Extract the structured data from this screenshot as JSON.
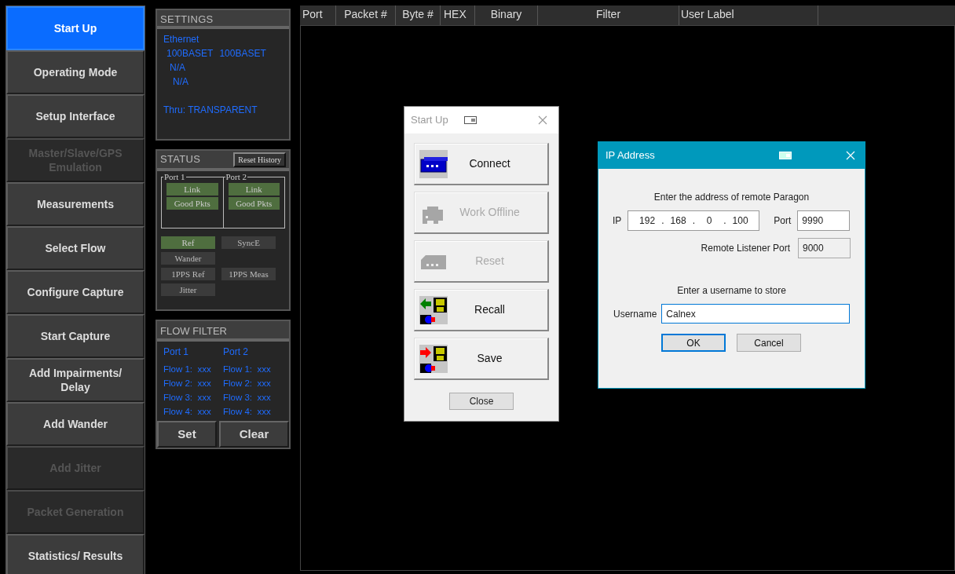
{
  "nav": [
    {
      "label": "Start Up",
      "selected": true,
      "disabled": false
    },
    {
      "label": "Operating Mode",
      "selected": false,
      "disabled": false
    },
    {
      "label": "Setup Interface",
      "selected": false,
      "disabled": false
    },
    {
      "label": "Master/Slave/GPS Emulation",
      "selected": false,
      "disabled": true
    },
    {
      "label": "Measurements",
      "selected": false,
      "disabled": false
    },
    {
      "label": "Select Flow",
      "selected": false,
      "disabled": false
    },
    {
      "label": "Configure Capture",
      "selected": false,
      "disabled": false
    },
    {
      "label": "Start Capture",
      "selected": false,
      "disabled": false
    },
    {
      "label": "Add Impairments/ Delay",
      "selected": false,
      "disabled": false
    },
    {
      "label": "Add Wander",
      "selected": false,
      "disabled": false
    },
    {
      "label": "Add Jitter",
      "selected": false,
      "disabled": true
    },
    {
      "label": "Packet Generation",
      "selected": false,
      "disabled": true
    },
    {
      "label": "Statistics/ Results",
      "selected": false,
      "disabled": false
    }
  ],
  "settings": {
    "title": "SETTINGS",
    "lines": [
      [
        "Ethernet"
      ],
      [
        "100BASET",
        "100BASET"
      ],
      [
        "N/A"
      ],
      [
        "N/A"
      ],
      [
        "Thru: TRANSPARENT"
      ]
    ]
  },
  "status": {
    "title": "STATUS",
    "reset_button": "Reset History",
    "ports": [
      {
        "label": "Port 1",
        "indicators": [
          {
            "label": "Link",
            "on": true
          },
          {
            "label": "Good Pkts",
            "on": true
          }
        ]
      },
      {
        "label": "Port 2",
        "indicators": [
          {
            "label": "Link",
            "on": true
          },
          {
            "label": "Good Pkts",
            "on": true
          }
        ]
      }
    ],
    "indicator_rows": [
      [
        {
          "label": "Ref",
          "on": true
        },
        {
          "label": "SyncE",
          "on": false
        }
      ],
      [
        {
          "label": "Wander",
          "on": false
        }
      ],
      [
        {
          "label": "1PPS Ref",
          "on": false
        },
        {
          "label": "1PPS Meas",
          "on": false
        }
      ],
      [
        {
          "label": "Jitter",
          "on": false
        }
      ]
    ]
  },
  "flow_filter": {
    "title": "FLOW FILTER",
    "ports": [
      {
        "label": "Port 1",
        "flows": [
          "Flow 1:  xxx",
          "Flow 2:  xxx",
          "Flow 3:  xxx",
          "Flow 4:  xxx"
        ]
      },
      {
        "label": "Port 2",
        "flows": [
          "Flow 1:  xxx",
          "Flow 2:  xxx",
          "Flow 3:  xxx",
          "Flow 4:  xxx"
        ]
      }
    ],
    "buttons": [
      "Set",
      "Clear"
    ]
  },
  "table": {
    "columns": [
      "Port",
      "Packet #",
      "Byte #",
      "HEX",
      "Binary",
      "Filter",
      "User Label"
    ]
  },
  "startup_dialog": {
    "title": "Start Up",
    "buttons": [
      {
        "label": "Connect",
        "kind": "connect",
        "disabled": false
      },
      {
        "label": "Work Offline",
        "kind": "offline",
        "disabled": true
      },
      {
        "label": "Reset",
        "kind": "reset",
        "disabled": true
      },
      {
        "label": "Recall",
        "kind": "recall",
        "disabled": false
      },
      {
        "label": "Save",
        "kind": "save",
        "disabled": false
      }
    ],
    "close_button": "Close"
  },
  "ip_dialog": {
    "title": "IP Address",
    "prompt": "Enter the address of remote Paragon",
    "ip_label": "IP",
    "ip_octets": [
      "192",
      "168",
      "0",
      "100"
    ],
    "ip_separator": ".",
    "port_label": "Port",
    "port_value": "9990",
    "listener_label": "Remote Listener Port",
    "listener_value": "9000",
    "username_prompt": "Enter a username to store",
    "username_label": "Username",
    "username_value": "Calnex",
    "buttons": [
      {
        "label": "OK",
        "default": true
      },
      {
        "label": "Cancel",
        "default": false
      }
    ]
  }
}
